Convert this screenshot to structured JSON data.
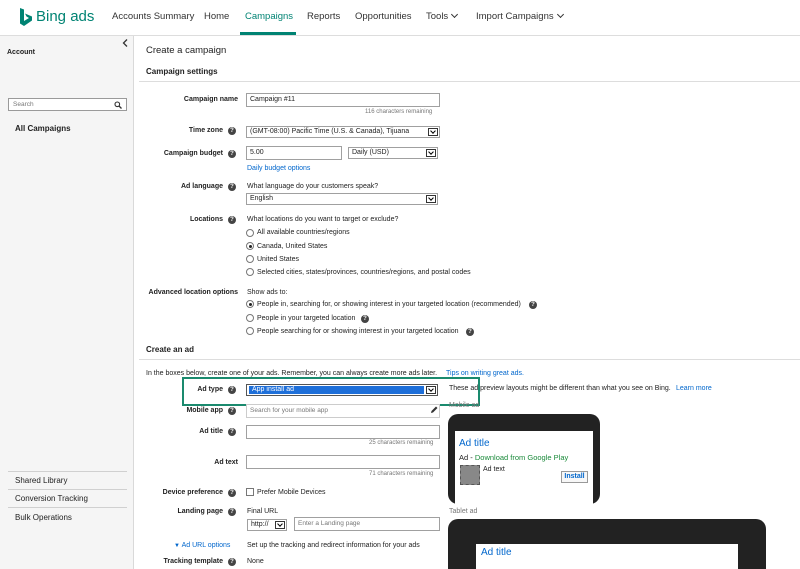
{
  "brand": {
    "name": "Bing ads",
    "color": "#008373"
  },
  "nav": {
    "items": [
      "Accounts Summary",
      "Home",
      "Campaigns",
      "Reports",
      "Opportunities"
    ],
    "tools": "Tools",
    "import": "Import Campaigns",
    "active": "Campaigns"
  },
  "sidebar": {
    "collapse_icon": "chevron-left-icon",
    "account_label": "Account",
    "search_placeholder": "Search",
    "all_campaigns": "All Campaigns",
    "bottom": [
      "Shared Library",
      "Conversion Tracking",
      "Bulk Operations"
    ]
  },
  "page": {
    "title": "Create a campaign",
    "settings_heading": "Campaign settings"
  },
  "form": {
    "campaign_name_label": "Campaign name",
    "campaign_name_value": "Campaign #11",
    "campaign_name_remaining": "116 characters remaining",
    "timezone_label": "Time zone",
    "timezone_value": "(GMT-08:00) Pacific Time (U.S. & Canada), Tijuana",
    "budget_label": "Campaign budget",
    "budget_value": "5.00",
    "budget_type": "Daily (USD)",
    "budget_options_link": "Daily budget options",
    "ad_language_label": "Ad language",
    "ad_language_question": "What language do your customers speak?",
    "ad_language_value": "English",
    "locations_label": "Locations",
    "locations_question": "What locations do you want to target or exclude?",
    "locations_options": [
      "All available countries/regions",
      "Canada, United States",
      "United States",
      "Selected cities, states/provinces, countries/regions, and postal codes"
    ],
    "locations_selected": 1,
    "adv_label": "Advanced location options",
    "adv_show": "Show ads to:",
    "adv_options": [
      "People in, searching for, or showing interest in your targeted location (recommended)",
      "People in your targeted location",
      "People searching for or showing interest in your targeted location"
    ],
    "adv_selected": 0
  },
  "create_ad": {
    "heading": "Create an ad",
    "intro": "In the boxes below, create one of your ads. Remember, you can always create more ads later.",
    "tips_link": "Tips on writing great ads.",
    "ad_type_label": "Ad type",
    "ad_type_value": "App install ad",
    "preview_note": "These ad preview layouts might be different than what you see on Bing.",
    "learn_more": "Learn more",
    "mobile_app_label": "Mobile app",
    "mobile_app_placeholder": "Search for your mobile app",
    "ad_title_label": "Ad title",
    "ad_title_remaining": "25 characters remaining",
    "ad_text_label": "Ad text",
    "ad_text_remaining": "71 characters remaining",
    "device_pref_label": "Device preference",
    "device_pref_option": "Prefer Mobile Devices",
    "landing_label": "Landing page",
    "final_url": "Final URL",
    "protocol": "http://",
    "landing_placeholder": "Enter a Landing page",
    "ad_url_options": "Ad URL options",
    "ad_url_desc": "Set up the tracking and redirect information for your ads",
    "tracking_label": "Tracking template",
    "tracking_value": "None",
    "highlight_color": "#1a8a6e"
  },
  "preview": {
    "mobile_label": "Mobile ad",
    "ad_title": "Ad title",
    "ad_prefix": "Ad",
    "ad_download": "Download from Google Play",
    "ad_text": "Ad text",
    "install_button": "Install",
    "tablet_label": "Tablet ad",
    "tablet_title": "Ad title"
  }
}
